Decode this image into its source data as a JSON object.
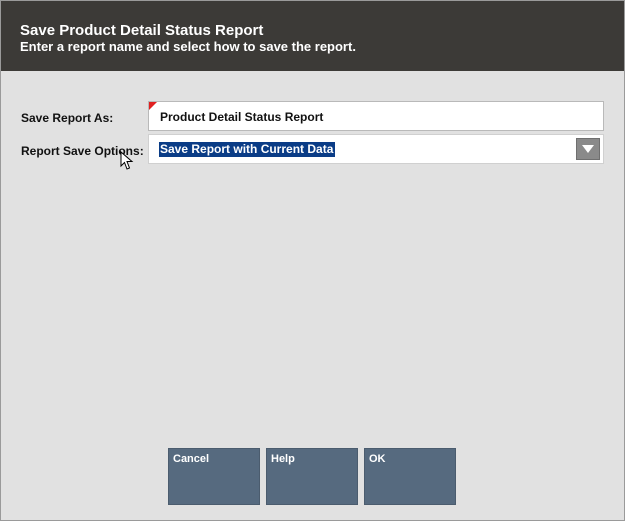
{
  "header": {
    "title": "Save Product Detail Status Report",
    "subtitle": "Enter a report name and select how to save the report."
  },
  "form": {
    "report_name_label": "Save Report As:",
    "report_name_value": "Product Detail Status Report",
    "save_options_label": "Report Save Options:",
    "save_options_value": "Save Report with Current Data"
  },
  "buttons": {
    "cancel": "Cancel",
    "help": "Help",
    "ok": "OK"
  },
  "colors": {
    "header_bg": "#3c3a37",
    "body_bg": "#e1e1e1",
    "button_bg": "#566a7f",
    "selection_bg": "#0a3c86",
    "required_mark": "#e02020"
  },
  "icons": {
    "dropdown": "chevron-down-icon",
    "cursor": "mouse-pointer-icon",
    "required": "required-field-marker"
  }
}
